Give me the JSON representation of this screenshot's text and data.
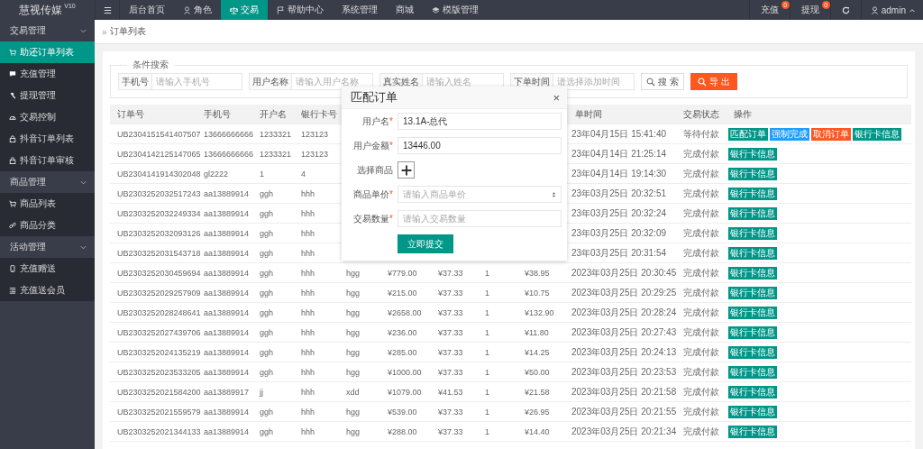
{
  "brand": {
    "name": "慧视传媒",
    "version": "V10"
  },
  "top_nav": {
    "menu_glyph": "☰",
    "items": [
      {
        "label": "后台首页",
        "selected": false
      },
      {
        "label": "角色",
        "selected": false
      },
      {
        "label": "交易",
        "selected": true
      },
      {
        "label": "帮助中心",
        "selected": false
      },
      {
        "label": "系统管理",
        "selected": false
      },
      {
        "label": "商城",
        "selected": false
      },
      {
        "label": "模版管理",
        "selected": false
      }
    ],
    "right": [
      {
        "label": "充值",
        "badge": "0"
      },
      {
        "label": "提现",
        "badge": "0"
      }
    ],
    "user": "admin"
  },
  "sidebar": {
    "groups": [
      {
        "title": "交易管理",
        "expanded": true,
        "items": [
          {
            "label": "助还订单列表",
            "selected": true
          },
          {
            "label": "充值管理",
            "selected": false
          },
          {
            "label": "提现管理",
            "selected": false
          },
          {
            "label": "交易控制",
            "selected": false
          },
          {
            "label": "抖音订单列表",
            "selected": false
          },
          {
            "label": "抖音订单审核",
            "selected": false
          }
        ]
      },
      {
        "title": "商品管理",
        "expanded": true,
        "items": [
          {
            "label": "商品列表",
            "selected": false
          },
          {
            "label": "商品分类",
            "selected": false
          }
        ]
      },
      {
        "title": "活动管理",
        "expanded": true,
        "items": [
          {
            "label": "充值赠送",
            "selected": false
          },
          {
            "label": "充值送会员",
            "selected": false
          }
        ]
      }
    ]
  },
  "breadcrumb": {
    "glyph": "»",
    "label": "订单列表"
  },
  "search": {
    "legend": "条件搜索",
    "fields": [
      {
        "label": "手机号",
        "placeholder": "请输入手机号"
      },
      {
        "label": "用户名称",
        "placeholder": "请输入用户名称"
      },
      {
        "label": "真实姓名",
        "placeholder": "请输入姓名"
      },
      {
        "label": "下单时间",
        "placeholder": "请选择添加时间"
      }
    ],
    "search_button": "搜 索",
    "export_button": "导 出"
  },
  "table": {
    "columns": [
      "订单号",
      "手机号",
      "开户名",
      "银行卡号",
      "单时间",
      "交易状态",
      "操作"
    ],
    "rows": [
      {
        "order_no": "UB2304151541407507",
        "phone": "13666666666",
        "account_name": "1233321",
        "card_no": "123123",
        "time": "23年04月15日 15:41:40",
        "status": "等待付款",
        "actions": [
          {
            "label": "匹配订单",
            "kind": "match"
          },
          {
            "label": "强制完成",
            "kind": "force"
          },
          {
            "label": "取消订单",
            "kind": "cancel"
          },
          {
            "label": "银行卡信息",
            "kind": "bank"
          }
        ]
      },
      {
        "order_no": "UB2304142125147065",
        "phone": "13666666666",
        "account_name": "1233321",
        "card_no": "123123",
        "time": "23年04月14日 21:25:14",
        "status": "完成付款",
        "actions": [
          {
            "label": "银行卡信息",
            "kind": "bank"
          }
        ]
      },
      {
        "order_no": "UB2304141914302048",
        "phone": "gl2222",
        "account_name": "1",
        "card_no": "4",
        "time": "23年04月14日 19:14:30",
        "status": "完成付款",
        "actions": [
          {
            "label": "银行卡信息",
            "kind": "bank"
          }
        ]
      },
      {
        "order_no": "UB2303252032517243",
        "phone": "aa13889914",
        "account_name": "ggh",
        "card_no": "hhh",
        "time": "23年03月25日 20:32:51",
        "status": "完成付款",
        "actions": [
          {
            "label": "银行卡信息",
            "kind": "bank"
          }
        ]
      },
      {
        "order_no": "UB2303252032249334",
        "phone": "aa13889914",
        "account_name": "ggh",
        "card_no": "hhh",
        "time": "23年03月25日 20:32:24",
        "status": "完成付款",
        "actions": [
          {
            "label": "银行卡信息",
            "kind": "bank"
          }
        ]
      },
      {
        "order_no": "UB2303252032093126",
        "phone": "aa13889914",
        "account_name": "ggh",
        "card_no": "hhh",
        "time": "23年03月25日 20:32:09",
        "status": "完成付款",
        "actions": [
          {
            "label": "银行卡信息",
            "kind": "bank"
          }
        ]
      },
      {
        "order_no": "UB2303252031543718",
        "phone": "aa13889914",
        "account_name": "ggh",
        "card_no": "hhh",
        "time": "23年03月25日 20:31:54",
        "status": "完成付款",
        "actions": [
          {
            "label": "银行卡信息",
            "kind": "bank"
          }
        ]
      },
      {
        "order_no": "UB2303252030459694",
        "phone": "aa13889914",
        "account_name": "ggh",
        "card_no": "hhh",
        "column_5": "hgg",
        "column_6": "¥779.00",
        "column_7": "¥37.33",
        "column_8": "1",
        "column_9": "¥38.95",
        "time": "2023年03月25日 20:30:45",
        "status": "完成付款",
        "actions": [
          {
            "label": "银行卡信息",
            "kind": "bank"
          }
        ]
      },
      {
        "order_no": "UB2303252029257909",
        "phone": "aa13889914",
        "account_name": "ggh",
        "card_no": "hhh",
        "column_5": "hgg",
        "column_6": "¥215.00",
        "column_7": "¥37.33",
        "column_8": "1",
        "column_9": "¥10.75",
        "time": "2023年03月25日 20:29:25",
        "status": "完成付款",
        "actions": [
          {
            "label": "银行卡信息",
            "kind": "bank"
          }
        ]
      },
      {
        "order_no": "UB2303252028248641",
        "phone": "aa13889914",
        "account_name": "ggh",
        "card_no": "hhh",
        "column_5": "hgg",
        "column_6": "¥2658.00",
        "column_7": "¥37.33",
        "column_8": "1",
        "column_9": "¥132.90",
        "time": "2023年03月25日 20:28:24",
        "status": "完成付款",
        "actions": [
          {
            "label": "银行卡信息",
            "kind": "bank"
          }
        ]
      },
      {
        "order_no": "UB2303252027439706",
        "phone": "aa13889914",
        "account_name": "ggh",
        "card_no": "hhh",
        "column_5": "hgg",
        "column_6": "¥236.00",
        "column_7": "¥37.33",
        "column_8": "1",
        "column_9": "¥11.80",
        "time": "2023年03月25日 20:27:43",
        "status": "完成付款",
        "actions": [
          {
            "label": "银行卡信息",
            "kind": "bank"
          }
        ]
      },
      {
        "order_no": "UB2303252024135219",
        "phone": "aa13889914",
        "account_name": "ggh",
        "card_no": "hhh",
        "column_5": "hgg",
        "column_6": "¥285.00",
        "column_7": "¥37.33",
        "column_8": "1",
        "column_9": "¥14.25",
        "time": "2023年03月25日 20:24:13",
        "status": "完成付款",
        "actions": [
          {
            "label": "银行卡信息",
            "kind": "bank"
          }
        ]
      },
      {
        "order_no": "UB2303252023533205",
        "phone": "aa13889914",
        "account_name": "ggh",
        "card_no": "hhh",
        "column_5": "hgg",
        "column_6": "¥1000.00",
        "column_7": "¥37.33",
        "column_8": "1",
        "column_9": "¥50.00",
        "time": "2023年03月25日 20:23:53",
        "status": "完成付款",
        "actions": [
          {
            "label": "银行卡信息",
            "kind": "bank"
          }
        ]
      },
      {
        "order_no": "UB2303252021584200",
        "phone": "aa13889917",
        "account_name": "jj",
        "card_no": "hhh",
        "column_5": "xdd",
        "column_6": "¥1079.00",
        "column_7": "¥41.53",
        "column_8": "1",
        "column_9": "¥21.58",
        "time": "2023年03月25日 20:21:58",
        "status": "完成付款",
        "actions": [
          {
            "label": "银行卡信息",
            "kind": "bank"
          }
        ]
      },
      {
        "order_no": "UB2303252021559579",
        "phone": "aa13889914",
        "account_name": "ggh",
        "card_no": "hhh",
        "column_5": "hgg",
        "column_6": "¥539.00",
        "column_7": "¥37.33",
        "column_8": "1",
        "column_9": "¥26.95",
        "time": "2023年03月25日 20:21:55",
        "status": "完成付款",
        "actions": [
          {
            "label": "银行卡信息",
            "kind": "bank"
          }
        ]
      },
      {
        "order_no": "UB2303252021344133",
        "phone": "aa13889914",
        "account_name": "ggh",
        "card_no": "hhh",
        "column_5": "hgg",
        "column_6": "¥288.00",
        "column_7": "¥37.33",
        "column_8": "1",
        "column_9": "¥14.40",
        "time": "2023年03月25日 20:21:34",
        "status": "完成付款",
        "actions": [
          {
            "label": "银行卡信息",
            "kind": "bank"
          }
        ]
      }
    ]
  },
  "dialog": {
    "title": "匹配订单",
    "close_glyph": "×",
    "required_glyph": "*",
    "fields": [
      {
        "kind": "text",
        "label": "用户名",
        "required": true,
        "value": "13.1A-总代"
      },
      {
        "kind": "text",
        "label": "用户金额",
        "required": true,
        "value": "13446.00"
      },
      {
        "kind": "add",
        "label": "选择商品",
        "required": false
      },
      {
        "kind": "select",
        "label": "商品单价",
        "required": true,
        "placeholder": "请输入商品单价"
      },
      {
        "kind": "text",
        "label": "交易数量",
        "required": true,
        "placeholder": "请输入交易数量"
      }
    ],
    "submit": "立即提交"
  }
}
